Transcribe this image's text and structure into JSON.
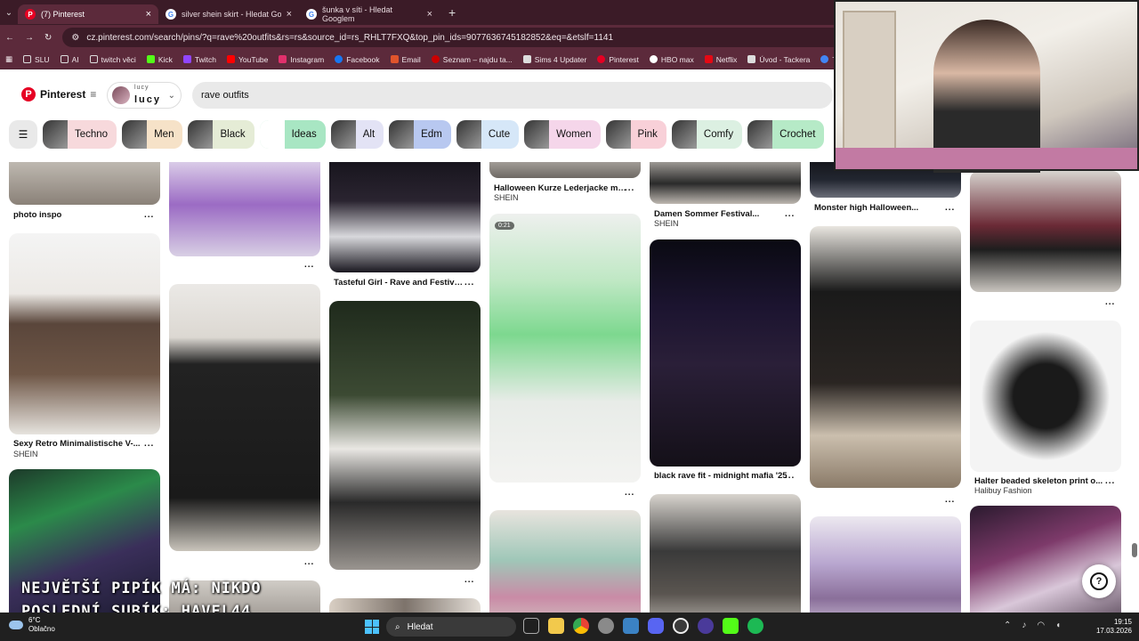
{
  "browser": {
    "tabs": [
      {
        "title": "(7) Pinterest",
        "icon": "pinterest",
        "active": true
      },
      {
        "title": "silver shein skirt - Hledat Googl",
        "icon": "google",
        "active": false
      },
      {
        "title": "šunka v síti - Hledat Googlem",
        "icon": "google",
        "active": false
      }
    ],
    "url": "cz.pinterest.com/search/pins/?q=rave%20outfits&rs=rs&source_id=rs_RHLT7FXQ&top_pin_ids=907763674518285​2&eq=&etslf=1141",
    "bookmarks": [
      "SLU",
      "AI",
      "twitch věci",
      "Kick",
      "Twitch",
      "YouTube",
      "Instagram",
      "Facebook",
      "Email",
      "Seznam – najdu ta...",
      "Sims 4 Updater",
      "Pinterest",
      "HBO max",
      "Netflix",
      "Úvod - Tackera",
      "TP"
    ]
  },
  "pinterest": {
    "logo_text": "Pinterest",
    "account_small": "lucy",
    "account_name": "lucy",
    "search_value": "rave outfits",
    "chips": [
      {
        "label": "Techno",
        "color": "#f7d9dc"
      },
      {
        "label": "Men",
        "color": "#f6e2c8"
      },
      {
        "label": "Black",
        "color": "#e5ecd6"
      },
      {
        "label": "Ideas",
        "color": "#a8e6c3"
      },
      {
        "label": "Alt",
        "color": "#e3e3f5"
      },
      {
        "label": "Edm",
        "color": "#b8c8f0"
      },
      {
        "label": "Cute",
        "color": "#d6e7f8"
      },
      {
        "label": "Women",
        "color": "#f5d6ea"
      },
      {
        "label": "Pink",
        "color": "#f8d0d8"
      },
      {
        "label": "Comfy",
        "color": "#dcf0e2"
      },
      {
        "label": "Crochet",
        "color": "#b6eac7"
      }
    ],
    "pins": {
      "photo_inspo": "photo inspo",
      "sexy_retro": "Sexy Retro Minimalistische V-...",
      "shein_1": "SHEIN",
      "tasteful": "Tasteful Girl - Rave and Festival...",
      "halloween": "Halloween Kurze Lederjacke mit...",
      "shein_2": "SHEIN",
      "video_duration": "0:21",
      "damen": "Damen Sommer Festival...",
      "shein_3": "SHEIN",
      "black_rave": "black rave fit - midnight mafia '25",
      "monster": "Monster high Halloween...",
      "halter": "Halter beaded skeleton print o...",
      "halibuy": "Halibuy Fashion",
      "more": "..."
    },
    "help": "?"
  },
  "stream_overlay": {
    "line1": "NEJVĚTŠÍ PIPÍK MÁ: NIKDO",
    "line2": "POSLEDNÍ SUBÍK: HAVEL44"
  },
  "taskbar": {
    "temp": "6°C",
    "weather": "Oblačno",
    "search": "Hledat",
    "time": "19:15",
    "date": "17.03.2026"
  }
}
